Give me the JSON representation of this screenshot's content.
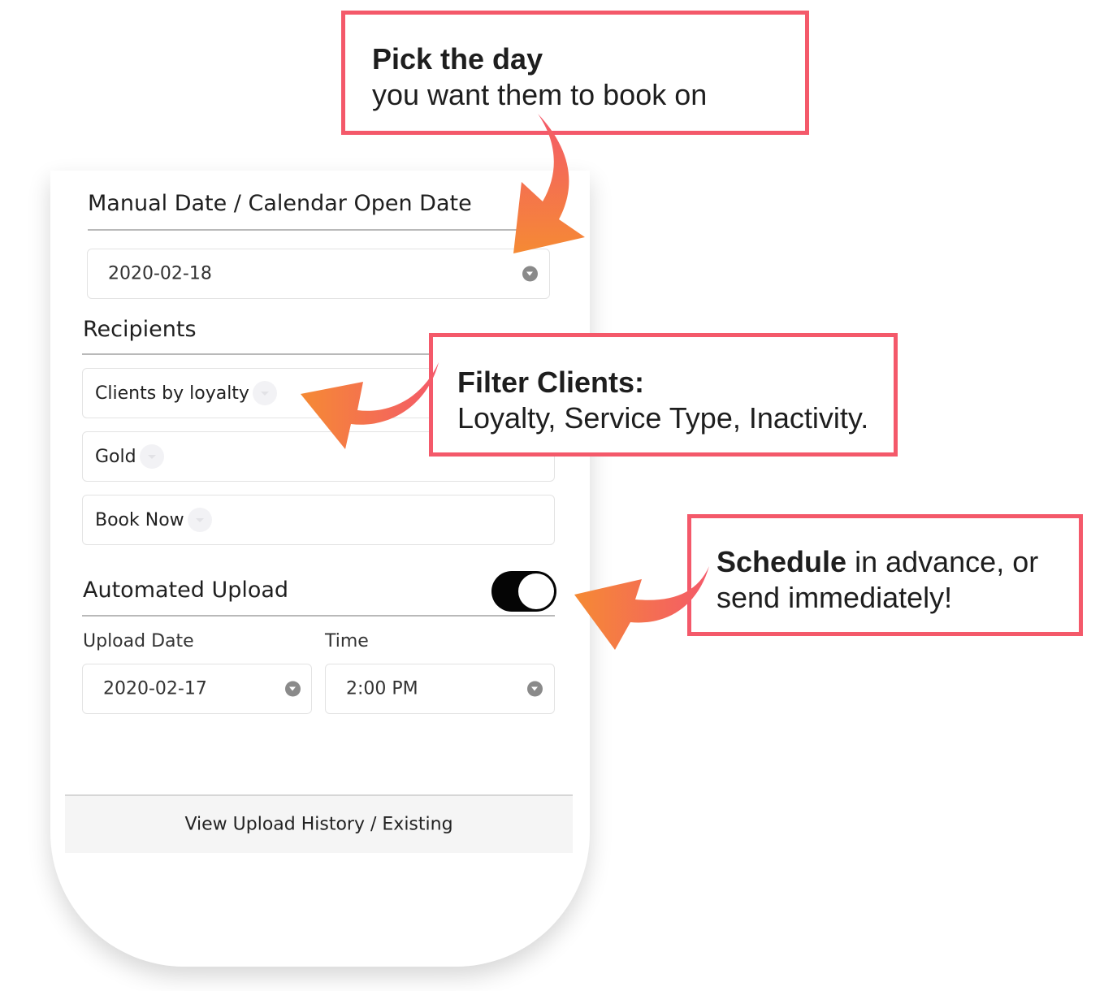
{
  "form": {
    "manual_date_heading": "Manual Date / Calendar Open Date",
    "manual_date_value": "2020-02-18",
    "recipients_heading": "Recipients",
    "recipient_filter_1": "Clients by loyalty",
    "recipient_filter_2": "Gold",
    "recipient_filter_3": "Book Now",
    "automated_upload_heading": "Automated Upload",
    "automated_upload_enabled": true,
    "upload_date_label": "Upload Date",
    "upload_date_value": "2020-02-17",
    "time_label": "Time",
    "time_value": "2:00 PM",
    "history_button": "View Upload History / Existing"
  },
  "callouts": {
    "pick_day": {
      "bold": "Pick the day",
      "text": "you want them to book on"
    },
    "filter_clients": {
      "bold": "Filter Clients:",
      "text": "Loyalty, Service Type, Inactivity."
    },
    "schedule": {
      "bold": "Schedule",
      "text_inline": " in advance, or",
      "text": "send immediately!"
    }
  },
  "colors": {
    "callout_border": "#f4596a",
    "arrow_start": "#f4596a",
    "arrow_end": "#f58a34",
    "toggle_on": "#050505"
  }
}
